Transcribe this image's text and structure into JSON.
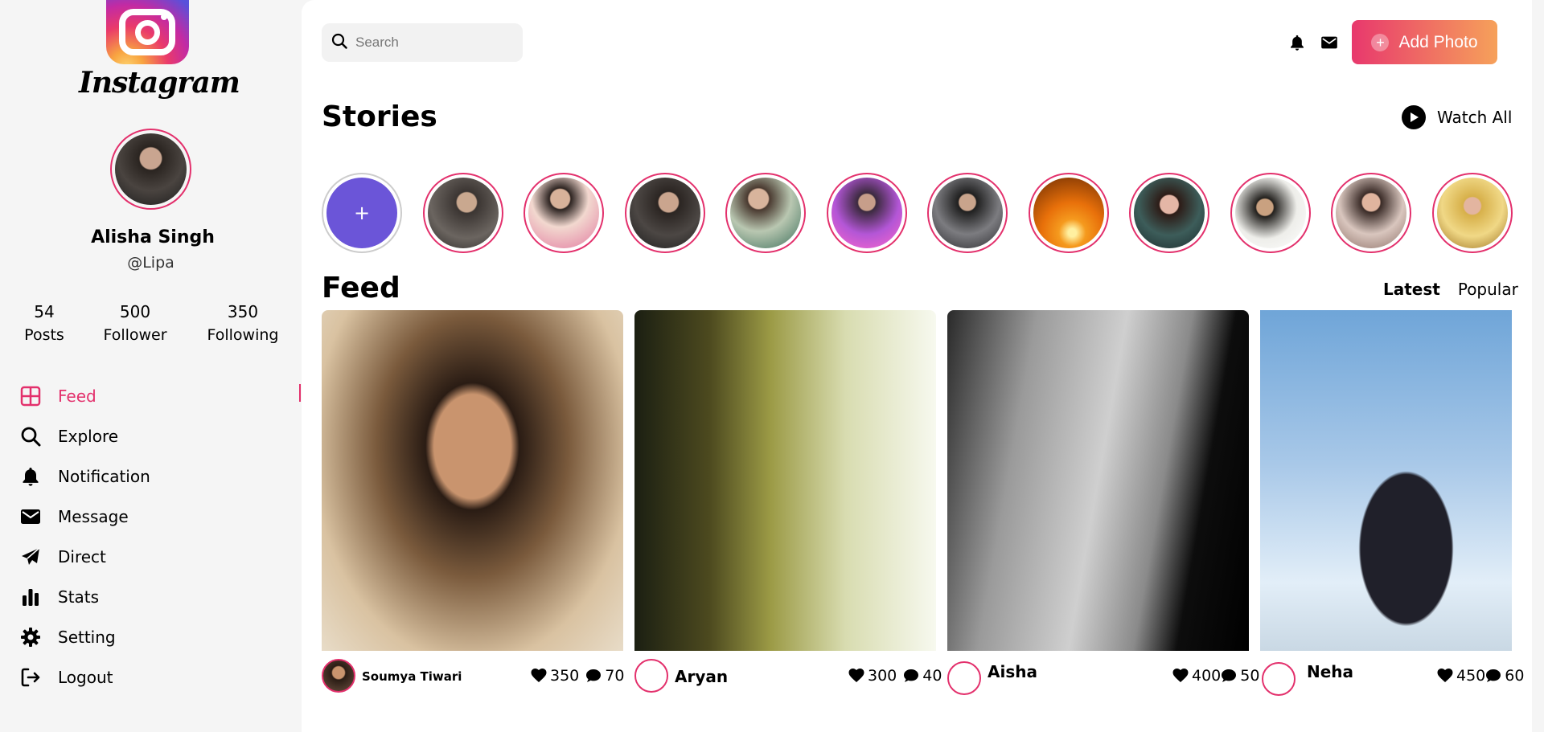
{
  "app": {
    "logo_text": "Instagram"
  },
  "profile": {
    "name": "Alisha Singh",
    "handle": "@Lipa"
  },
  "stats": [
    {
      "value": "54",
      "label": "Posts"
    },
    {
      "value": "500",
      "label": "Follower"
    },
    {
      "value": "350",
      "label": "Following"
    }
  ],
  "menu": [
    {
      "label": "Feed",
      "icon": "grid-icon",
      "active": true
    },
    {
      "label": "Explore",
      "icon": "search-icon"
    },
    {
      "label": "Notification",
      "icon": "bell-icon"
    },
    {
      "label": "Message",
      "icon": "envelope-icon"
    },
    {
      "label": "Direct",
      "icon": "paper-plane-icon"
    },
    {
      "label": "Stats",
      "icon": "bar-chart-icon"
    },
    {
      "label": "Setting",
      "icon": "gear-icon"
    },
    {
      "label": "Logout",
      "icon": "logout-icon"
    }
  ],
  "search": {
    "placeholder": "Search"
  },
  "header": {
    "add_photo_label": "Add Photo"
  },
  "stories": {
    "title": "Stories",
    "watch_all_label": "Watch All",
    "add_symbol": "+",
    "count": 12
  },
  "feed": {
    "title": "Feed",
    "tabs": [
      {
        "label": "Latest",
        "active": true
      },
      {
        "label": "Popular"
      }
    ],
    "posts": [
      {
        "author": "Soumya Tiwari",
        "likes": "350",
        "comments": "70"
      },
      {
        "author": "Aryan",
        "likes": "300",
        "comments": "40"
      },
      {
        "author": "Aisha",
        "likes": "400",
        "comments": "50"
      },
      {
        "author": "Neha",
        "likes": "450",
        "comments": "60"
      }
    ]
  },
  "colors": {
    "accent": "#e3306c",
    "gradient_start": "#e8386d",
    "gradient_end": "#f6a15a"
  }
}
